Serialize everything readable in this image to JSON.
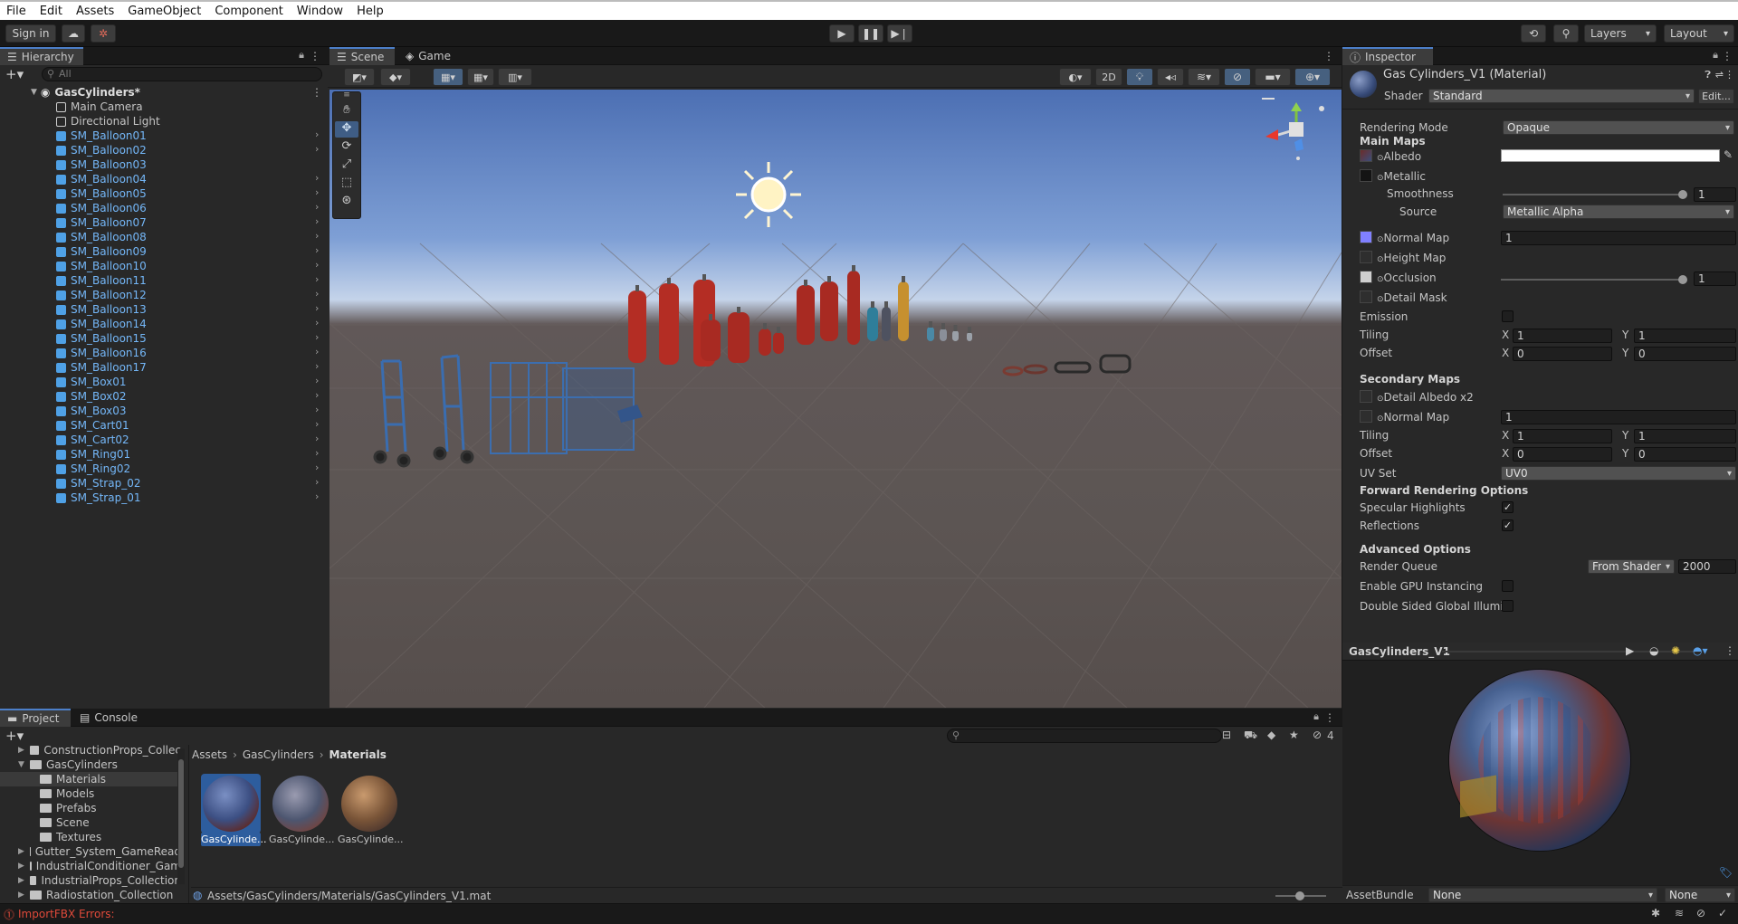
{
  "menu": {
    "items": [
      "File",
      "Edit",
      "Assets",
      "GameObject",
      "Component",
      "Window",
      "Help"
    ]
  },
  "toolbar": {
    "sign_in": "Sign in",
    "layers": "Layers",
    "layout": "Layout"
  },
  "hierarchy": {
    "tab": "Hierarchy",
    "search_placeholder": "All",
    "scene_name": "GasCylinders*",
    "items": [
      {
        "label": "Main Camera",
        "type": "object"
      },
      {
        "label": "Directional Light",
        "type": "object"
      },
      {
        "label": "SM_Balloon01",
        "type": "prefab"
      },
      {
        "label": "SM_Balloon02",
        "type": "prefab"
      },
      {
        "label": "SM_Balloon03",
        "type": "prefab"
      },
      {
        "label": "SM_Balloon04",
        "type": "prefab"
      },
      {
        "label": "SM_Balloon05",
        "type": "prefab"
      },
      {
        "label": "SM_Balloon06",
        "type": "prefab"
      },
      {
        "label": "SM_Balloon07",
        "type": "prefab"
      },
      {
        "label": "SM_Balloon08",
        "type": "prefab"
      },
      {
        "label": "SM_Balloon09",
        "type": "prefab"
      },
      {
        "label": "SM_Balloon10",
        "type": "prefab"
      },
      {
        "label": "SM_Balloon11",
        "type": "prefab"
      },
      {
        "label": "SM_Balloon12",
        "type": "prefab"
      },
      {
        "label": "SM_Balloon13",
        "type": "prefab"
      },
      {
        "label": "SM_Balloon14",
        "type": "prefab"
      },
      {
        "label": "SM_Balloon15",
        "type": "prefab"
      },
      {
        "label": "SM_Balloon16",
        "type": "prefab"
      },
      {
        "label": "SM_Balloon17",
        "type": "prefab"
      },
      {
        "label": "SM_Box01",
        "type": "prefab"
      },
      {
        "label": "SM_Box02",
        "type": "prefab"
      },
      {
        "label": "SM_Box03",
        "type": "prefab"
      },
      {
        "label": "SM_Cart01",
        "type": "prefab"
      },
      {
        "label": "SM_Cart02",
        "type": "prefab"
      },
      {
        "label": "SM_Ring01",
        "type": "prefab"
      },
      {
        "label": "SM_Ring02",
        "type": "prefab"
      },
      {
        "label": "SM_Strap_02",
        "type": "prefab"
      },
      {
        "label": "SM_Strap_01",
        "type": "prefab"
      }
    ]
  },
  "scene_view": {
    "tabs": [
      "Scene",
      "Game"
    ],
    "mode_2d": "2D"
  },
  "inspector": {
    "tab": "Inspector",
    "title": "Gas Cylinders_V1 (Material)",
    "shader_label": "Shader",
    "shader_value": "Standard",
    "edit_button": "Edit...",
    "rendering_mode_label": "Rendering Mode",
    "rendering_mode_value": "Opaque",
    "main_maps": "Main Maps",
    "albedo": "Albedo",
    "metallic": "Metallic",
    "smoothness": "Smoothness",
    "smoothness_value": "1",
    "source": "Source",
    "source_value": "Metallic Alpha",
    "normal_map": "Normal Map",
    "normal_value": "1",
    "height_map": "Height Map",
    "occlusion": "Occlusion",
    "occlusion_value": "1",
    "detail_mask": "Detail Mask",
    "emission": "Emission",
    "tiling": "Tiling",
    "offset": "Offset",
    "x_label": "X",
    "y_label": "Y",
    "tiling_x": "1",
    "tiling_y": "1",
    "offset_x": "0",
    "offset_y": "0",
    "secondary_maps": "Secondary Maps",
    "detail_albedo": "Detail Albedo x2",
    "normal_map2": "Normal Map",
    "normal2_value": "1",
    "tiling2_x": "1",
    "tiling2_y": "1",
    "offset2_x": "0",
    "offset2_y": "0",
    "uv_set": "UV Set",
    "uv_set_value": "UV0",
    "forward_options": "Forward Rendering Options",
    "specular": "Specular Highlights",
    "reflections": "Reflections",
    "advanced_options": "Advanced Options",
    "render_queue": "Render Queue",
    "render_queue_source": "From Shader",
    "render_queue_value": "2000",
    "gpu_instancing": "Enable GPU Instancing",
    "double_sided": "Double Sided Global Illumina",
    "preview_title": "GasCylinders_V1",
    "asset_bundle_label": "AssetBundle",
    "asset_bundle_value": "None",
    "asset_variant_value": "None"
  },
  "project": {
    "tabs": [
      "Project",
      "Console"
    ],
    "hidden_count": "4",
    "tree": [
      {
        "label": "ConstructionProps_Collec",
        "level": 1,
        "arrow": "right"
      },
      {
        "label": "GasCylinders",
        "level": 1,
        "arrow": "down"
      },
      {
        "label": "Materials",
        "level": 2,
        "arrow": ""
      },
      {
        "label": "Models",
        "level": 2,
        "arrow": ""
      },
      {
        "label": "Prefabs",
        "level": 2,
        "arrow": ""
      },
      {
        "label": "Scene",
        "level": 2,
        "arrow": ""
      },
      {
        "label": "Textures",
        "level": 2,
        "arrow": ""
      },
      {
        "label": "Gutter_System_GameRead",
        "level": 1,
        "arrow": "right"
      },
      {
        "label": "IndustrialConditioner_Gam",
        "level": 1,
        "arrow": "right"
      },
      {
        "label": "IndustrialProps_Collection",
        "level": 1,
        "arrow": "right"
      },
      {
        "label": "Radiostation_Collection",
        "level": 1,
        "arrow": "right"
      }
    ],
    "breadcrumb": [
      "Assets",
      "GasCylinders",
      "Materials"
    ],
    "assets": [
      "GasCylinde...",
      "GasCylinde...",
      "GasCylinde..."
    ],
    "path": "Assets/GasCylinders/Materials/GasCylinders_V1.mat"
  },
  "status": {
    "error": "ImportFBX Errors:"
  },
  "colors": {
    "accent": "#4c7fc9",
    "prefab_text": "#74b7f8",
    "error": "#e04a3a",
    "cylinder_red": "#b42d24"
  }
}
